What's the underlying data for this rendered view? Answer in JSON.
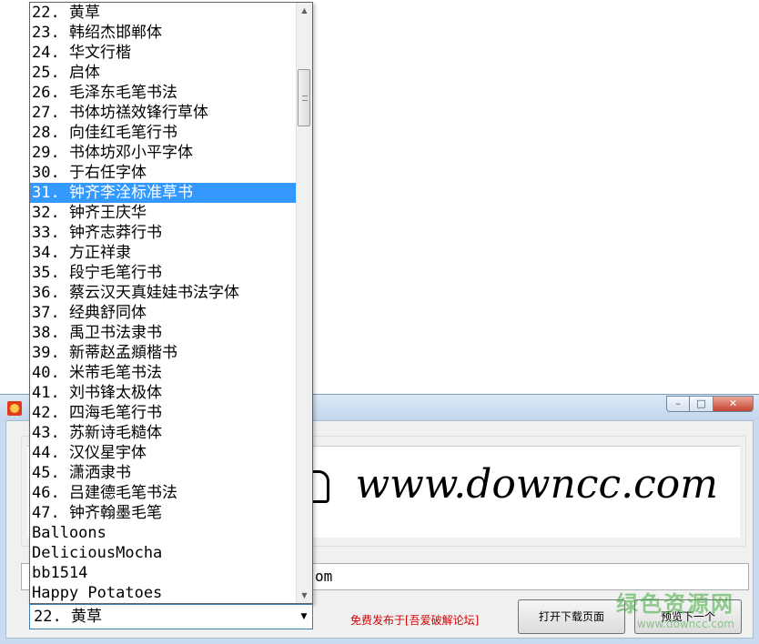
{
  "window": {
    "title": "",
    "preview_text": "www.downcc.com",
    "input_visible_tail": "om",
    "forum_text": "免费发布于[吾爱破解论坛]",
    "open_download_label": "打开下载页面",
    "preview_next_label": "预览下一个",
    "watermark_main": "绿色资源网",
    "watermark_sub": "www.downcc.com"
  },
  "font_combo": {
    "selected": "22. 黄草",
    "options": [
      "22. 黄草",
      "23. 韩绍杰邯郸体",
      "24. 华文行楷",
      "25. 启体",
      "26. 毛泽东毛笔书法",
      "27. 书体坊禚效锋行草体",
      "28. 向佳红毛笔行书",
      "29. 书体坊邓小平字体",
      "30. 于右任字体",
      "31. 钟齐李洤标准草书",
      "32. 钟齐王庆华",
      "33. 钟齐志莽行书",
      "34. 方正祥隶",
      "35. 段宁毛笔行书",
      "36. 蔡云汉天真娃娃书法字体",
      "37. 经典舒同体",
      "38. 禹卫书法隶书",
      "39. 新蒂赵孟頫楷书",
      "40. 米芾毛笔书法",
      "41. 刘书锋太极体",
      "42. 四海毛笔行书",
      "43. 苏新诗毛糙体",
      "44. 汉仪星宇体",
      "45. 潇洒隶书",
      "46. 吕建德毛笔书法",
      "47. 钟齐翰墨毛笔",
      "Balloons",
      "DeliciousMocha",
      "bb1514",
      "Happy Potatoes"
    ],
    "highlighted_index": 9,
    "scroll_position": 0.1,
    "visible_fraction": 0.1
  },
  "colors": {
    "highlight": "#3399ff",
    "forum_text": "#d40000",
    "watermark": "#3caa3c"
  }
}
